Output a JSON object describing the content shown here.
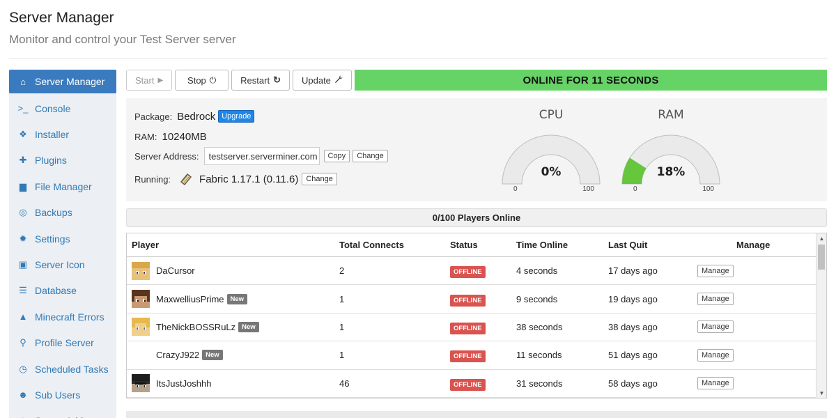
{
  "header": {
    "title": "Server Manager",
    "subtitle": "Monitor and control your Test Server server"
  },
  "sidebar": {
    "items": [
      {
        "label": "Server Manager",
        "icon": "home-icon",
        "glyph": "⌂"
      },
      {
        "label": "Console",
        "icon": "terminal-icon",
        "glyph": ">_"
      },
      {
        "label": "Installer",
        "icon": "cubes-icon",
        "glyph": "❖"
      },
      {
        "label": "Plugins",
        "icon": "puzzle-icon",
        "glyph": "✚"
      },
      {
        "label": "File Manager",
        "icon": "file-icon",
        "glyph": "▆"
      },
      {
        "label": "Backups",
        "icon": "lifebuoy-icon",
        "glyph": "◎"
      },
      {
        "label": "Settings",
        "icon": "gear-icon",
        "glyph": "✹"
      },
      {
        "label": "Server Icon",
        "icon": "image-icon",
        "glyph": "▣"
      },
      {
        "label": "Database",
        "icon": "database-icon",
        "glyph": "☰"
      },
      {
        "label": "Minecraft Errors",
        "icon": "warning-icon",
        "glyph": "▲"
      },
      {
        "label": "Profile Server",
        "icon": "search-icon",
        "glyph": "⚲"
      },
      {
        "label": "Scheduled Tasks",
        "icon": "clock-icon",
        "glyph": "◷"
      },
      {
        "label": "Sub Users",
        "icon": "users-icon",
        "glyph": "☻"
      },
      {
        "label": "Server Addons",
        "icon": "addons-icon",
        "glyph": "✦"
      }
    ]
  },
  "toolbar": {
    "start_label": "Start",
    "start_glyph": "▶",
    "stop_label": "Stop",
    "stop_glyph": "⏻",
    "restart_label": "Restart",
    "restart_glyph": "↻",
    "update_label": "Update",
    "update_glyph": "🔧"
  },
  "status": {
    "text": "ONLINE FOR 11 SECONDS",
    "color": "#66d366"
  },
  "info": {
    "package_label": "Package:",
    "package_value": "Bedrock",
    "upgrade_label": "Upgrade",
    "ram_label": "RAM:",
    "ram_value": "10240MB",
    "address_label": "Server Address:",
    "address_value": "testserver.serverminer.com",
    "copy_label": "Copy",
    "change_label": "Change",
    "running_label": "Running:",
    "running_value": "Fabric 1.17.1 (0.11.6)",
    "running_change_label": "Change"
  },
  "gauges": {
    "cpu": {
      "title": "CPU",
      "value": 0,
      "display": "0%",
      "min": "0",
      "max": "100",
      "fill_color": "#66c63c"
    },
    "ram": {
      "title": "RAM",
      "value": 18,
      "display": "18%",
      "min": "0",
      "max": "100",
      "fill_color": "#66c63c"
    }
  },
  "players": {
    "summary": "0/100 Players Online",
    "columns": [
      "Player",
      "Total Connects",
      "Status",
      "Time Online",
      "Last Quit",
      "Manage"
    ],
    "rows": [
      {
        "name": "DaCursor",
        "new": false,
        "badge": "",
        "connects": "2",
        "status": "OFFLINE",
        "time": "4 seconds",
        "quit": "17 days ago",
        "manage": "Manage",
        "avatar": "avatar-blonde"
      },
      {
        "name": "MaxwelliusPrime",
        "new": true,
        "badge": "New",
        "connects": "1",
        "status": "OFFLINE",
        "time": "9 seconds",
        "quit": "19 days ago",
        "manage": "Manage",
        "avatar": "avatar-brown"
      },
      {
        "name": "TheNickBOSSRuLz",
        "new": true,
        "badge": "New",
        "connects": "1",
        "status": "OFFLINE",
        "time": "38 seconds",
        "quit": "38 days ago",
        "manage": "Manage",
        "avatar": "avatar-blonde2"
      },
      {
        "name": "CrazyJ922",
        "new": true,
        "badge": "New",
        "connects": "1",
        "status": "OFFLINE",
        "time": "11 seconds",
        "quit": "51 days ago",
        "manage": "Manage",
        "avatar": "avatar-none"
      },
      {
        "name": "ItsJustJoshhh",
        "new": false,
        "badge": "",
        "connects": "46",
        "status": "OFFLINE",
        "time": "31 seconds",
        "quit": "58 days ago",
        "manage": "Manage",
        "avatar": "avatar-dark"
      }
    ]
  },
  "colors": {
    "accent": "#3a7bbf",
    "link": "#2f7ab7",
    "offline": "#d9534f",
    "upgrade": "#1f86e8"
  }
}
